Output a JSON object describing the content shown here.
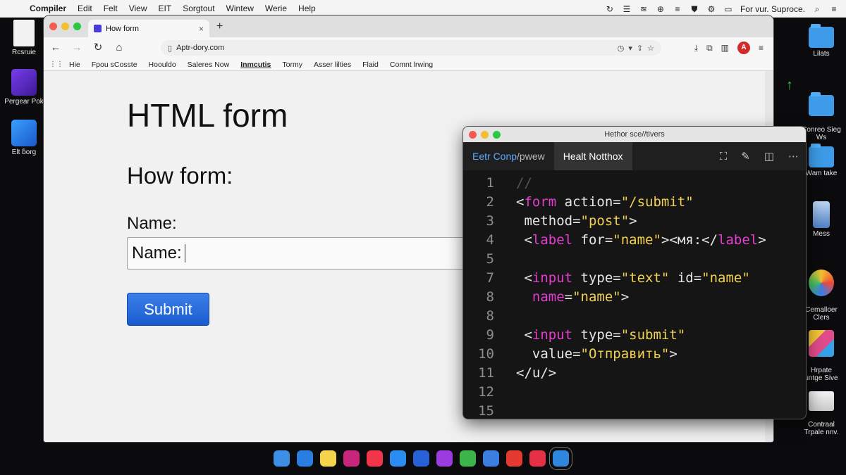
{
  "menubar": {
    "apple": "",
    "items": [
      "Compiler",
      "Edit",
      "Felt",
      "View",
      "EIT",
      "Sorgtout",
      "Wintew",
      "Werie",
      "Help"
    ],
    "status_text": "For vur. Suproce."
  },
  "desktop": {
    "left_icons": [
      {
        "label": "Rcsruie",
        "kind": "doc"
      },
      {
        "label": "Pergear Pok",
        "kind": "purple"
      },
      {
        "label": "Elt ƃorg",
        "kind": "blue"
      }
    ],
    "right_icons": [
      {
        "label": "Lilats",
        "kind": "folder"
      },
      {
        "label": "Conreo Sieg\nWs",
        "kind": "folder"
      },
      {
        "label": "Wam take",
        "kind": "folder"
      },
      {
        "label": "Mess",
        "kind": "phone"
      },
      {
        "label": "Cemalloer\nClers",
        "kind": "colorful"
      },
      {
        "label": "Hrpate\nuntge Sive",
        "kind": "multi"
      },
      {
        "label": "Contraal\nTrpale nnv.",
        "kind": "drive"
      }
    ]
  },
  "browser": {
    "tab_title": "How form",
    "tab_close": "×",
    "new_tab": "+",
    "url": "Aptr-dory.com",
    "bookmarks": [
      {
        "label": "Hie",
        "active": false
      },
      {
        "label": "Fpou sCosste",
        "active": false
      },
      {
        "label": "Hoouldo",
        "active": false
      },
      {
        "label": "Saleres Now",
        "active": false
      },
      {
        "label": "Inmcutis",
        "active": true
      },
      {
        "label": "Tormy",
        "active": false
      },
      {
        "label": "Asser lilties",
        "active": false
      },
      {
        "label": "Flaid",
        "active": false
      },
      {
        "label": "Comnt lrwing",
        "active": false
      }
    ],
    "profile_initial": "A"
  },
  "page": {
    "h1": "HTML form",
    "h2": "How form:",
    "name_label": "Name:",
    "input_value": "Name:",
    "submit_label": "Submit"
  },
  "editor": {
    "title": "Hethor sce//tivers",
    "tabs": [
      {
        "blue": "Eetr Conp",
        "rest": "/pwew",
        "active": false
      },
      {
        "blue": "",
        "rest": "Healt Notthox",
        "active": true
      }
    ],
    "lines": [
      {
        "n": "1",
        "tokens": [
          [
            "k-comment",
            "//"
          ]
        ]
      },
      {
        "n": "2",
        "tokens": [
          [
            "k-plain",
            "<"
          ],
          [
            "k-tag",
            "form"
          ],
          [
            "k-attr",
            " action="
          ],
          [
            "k-str",
            "\"/submit\""
          ]
        ]
      },
      {
        "n": "3",
        "tokens": [
          [
            "k-attr",
            " method="
          ],
          [
            "k-str",
            "\"post\""
          ],
          [
            "k-plain",
            ">"
          ]
        ]
      },
      {
        "n": "4",
        "tokens": [
          [
            "k-plain",
            " <"
          ],
          [
            "k-tag",
            "label"
          ],
          [
            "k-attr",
            " for="
          ],
          [
            "k-str",
            "\"name\""
          ],
          [
            "k-plain",
            "><мя:</"
          ],
          [
            "k-tag",
            "label"
          ],
          [
            "k-plain",
            ">"
          ]
        ]
      },
      {
        "n": "5",
        "tokens": []
      },
      {
        "n": "7",
        "tokens": [
          [
            "k-plain",
            " <"
          ],
          [
            "k-tag",
            "input"
          ],
          [
            "k-attr",
            " type="
          ],
          [
            "k-str",
            "\"text\""
          ],
          [
            "k-attr",
            " id="
          ],
          [
            "k-str",
            "\"name\""
          ]
        ]
      },
      {
        "n": "8",
        "tokens": [
          [
            "k-tag",
            "  name"
          ],
          [
            "k-attr",
            "="
          ],
          [
            "k-str",
            "\"name\""
          ],
          [
            "k-plain",
            ">"
          ]
        ]
      },
      {
        "n": "8",
        "tokens": []
      },
      {
        "n": "9",
        "tokens": [
          [
            "k-plain",
            " <"
          ],
          [
            "k-tag",
            "input"
          ],
          [
            "k-attr",
            " type="
          ],
          [
            "k-str",
            "\"submit\""
          ]
        ]
      },
      {
        "n": "10",
        "tokens": [
          [
            "k-plain",
            "  value="
          ],
          [
            "k-str",
            "\"Отправить\""
          ],
          [
            "k-plain",
            ">"
          ]
        ]
      },
      {
        "n": "11",
        "tokens": [
          [
            "k-plain",
            "</u/>"
          ]
        ]
      },
      {
        "n": "12",
        "tokens": []
      },
      {
        "n": "15",
        "tokens": []
      }
    ]
  },
  "dock": {
    "apps": [
      {
        "name": "finder",
        "color": "#3d8fe6"
      },
      {
        "name": "safari",
        "color": "#2a7de1"
      },
      {
        "name": "notes",
        "color": "#f4d44a"
      },
      {
        "name": "app-1",
        "color": "#c8257c"
      },
      {
        "name": "music",
        "color": "#f2344b"
      },
      {
        "name": "app-store",
        "color": "#2a8cf0"
      },
      {
        "name": "app-2",
        "color": "#2860d6"
      },
      {
        "name": "help",
        "color": "#9c3be0"
      },
      {
        "name": "chrome",
        "color": "#3bb54a"
      },
      {
        "name": "app-3",
        "color": "#3b7de0"
      },
      {
        "name": "app-4",
        "color": "#e6392f"
      },
      {
        "name": "app-5",
        "color": "#e63045"
      },
      {
        "name": "vscode",
        "color": "#2f86df"
      }
    ]
  }
}
